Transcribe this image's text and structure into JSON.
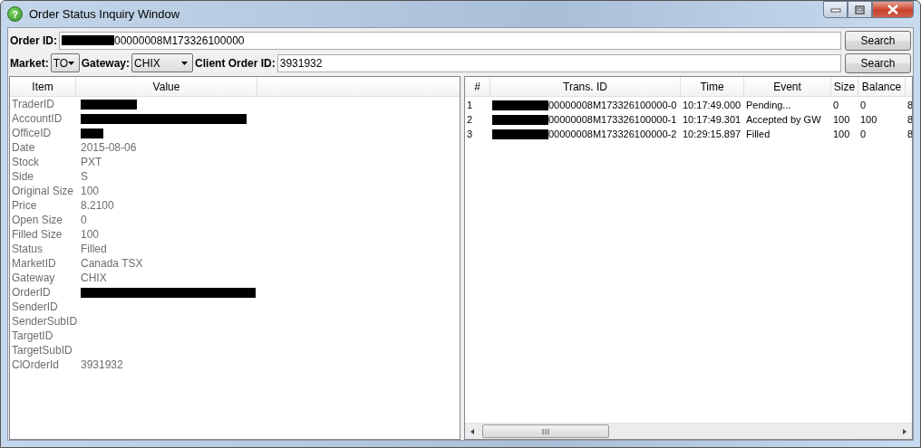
{
  "window": {
    "title": "Order Status Inquiry Window",
    "icon": "?"
  },
  "order_id": {
    "label": "Order ID:",
    "redacted": true,
    "value": "00000008M173326100000",
    "button": "Search"
  },
  "filters": {
    "market": {
      "label": "Market:",
      "value": "TO"
    },
    "gateway": {
      "label": "Gateway:",
      "value": "CHIX"
    },
    "client_order_id": {
      "label": "Client Order ID:",
      "value": "3931932"
    },
    "button": "Search"
  },
  "details": {
    "columns": [
      "Item",
      "Value"
    ],
    "rows": [
      {
        "item": "TraderID",
        "redacted": true
      },
      {
        "item": "AccountID",
        "redacted": true
      },
      {
        "item": "OfficeID",
        "redacted": true
      },
      {
        "item": "Date",
        "value": "2015-08-06"
      },
      {
        "item": "Stock",
        "value": "PXT"
      },
      {
        "item": "Side",
        "value": "S"
      },
      {
        "item": "Original Size",
        "value": "100"
      },
      {
        "item": "Price",
        "value": "8.2100"
      },
      {
        "item": "Open Size",
        "value": "0"
      },
      {
        "item": "Filled Size",
        "value": "100"
      },
      {
        "item": "Status",
        "value": "Filled"
      },
      {
        "item": "MarketID",
        "value": "Canada TSX"
      },
      {
        "item": "Gateway",
        "value": "CHIX"
      },
      {
        "item": "OrderID",
        "redacted": true
      },
      {
        "item": "SenderID"
      },
      {
        "item": "SenderSubID"
      },
      {
        "item": "TargetID"
      },
      {
        "item": "TargetSubID"
      },
      {
        "item": "ClOrderId",
        "value": "3931932"
      }
    ]
  },
  "transactions": {
    "columns": [
      "#",
      "Trans. ID",
      "Time",
      "Event",
      "Size",
      "Balance"
    ],
    "rows": [
      {
        "num": "1",
        "redacted": true,
        "trans_id": "00000008M173326100000-0",
        "time": "10:17:49.000",
        "event": "Pending...",
        "size": "0",
        "balance": "0",
        "column_7": "8"
      },
      {
        "num": "2",
        "redacted": true,
        "trans_id": "00000008M173326100000-1",
        "time": "10:17:49.301",
        "event": "Accepted by GW",
        "size": "100",
        "balance": "100",
        "column_7": "8"
      },
      {
        "num": "3",
        "redacted": true,
        "trans_id": "00000008M173326100000-2",
        "time": "10:29:15.897",
        "event": "Filled",
        "size": "100",
        "balance": "0",
        "column_7": "8"
      }
    ]
  }
}
